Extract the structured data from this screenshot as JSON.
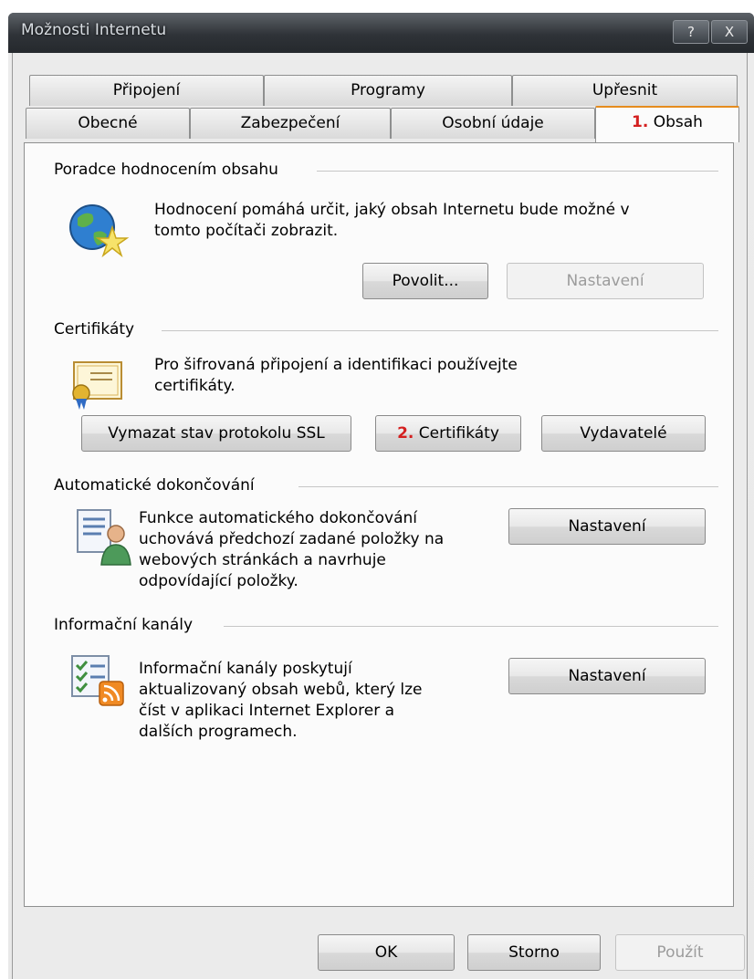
{
  "window": {
    "title": "Možnosti Internetu",
    "help_label": "?",
    "close_label": "X"
  },
  "tabs": {
    "row1": [
      "Připojení",
      "Programy",
      "Upřesnit"
    ],
    "row2": [
      "Obecné",
      "Zabezpečení",
      "Osobní údaje"
    ],
    "active_number": "1.",
    "active_label": "Obsah"
  },
  "content_advisor": {
    "title": "Poradce hodnocením obsahu",
    "description_line1": "Hodnocení pomáhá určit, jaký obsah Internetu bude možné v",
    "description_line2": "tomto počítači zobrazit.",
    "enable_label": "Povolit...",
    "settings_label": "Nastavení"
  },
  "certificates": {
    "title": "Certifikáty",
    "description_line1": "Pro šifrovaná připojení a identifikaci používejte",
    "description_line2": "certifikáty.",
    "clear_ssl_label": "Vymazat stav protokolu SSL",
    "certificates_number": "2.",
    "certificates_label": "Certifikáty",
    "publishers_label": "Vydavatelé"
  },
  "autocomplete": {
    "title": "Automatické dokončování",
    "description_line1": "Funkce automatického dokončování",
    "description_line2": "uchovává předchozí zadané položky na",
    "description_line3": "webových stránkách a navrhuje",
    "description_line4": "odpovídající položky.",
    "settings_label": "Nastavení"
  },
  "feeds": {
    "title": "Informační kanály",
    "description_line1": "Informační kanály poskytují",
    "description_line2": "aktualizovaný obsah webů, který lze",
    "description_line3": "číst v aplikaci Internet Explorer a",
    "description_line4": "dalších programech.",
    "settings_label": "Nastavení"
  },
  "footer": {
    "ok_label": "OK",
    "cancel_label": "Storno",
    "apply_label": "Použít"
  },
  "colors": {
    "annotation_red": "#d42020",
    "active_tab_accent": "#e58c1e"
  }
}
